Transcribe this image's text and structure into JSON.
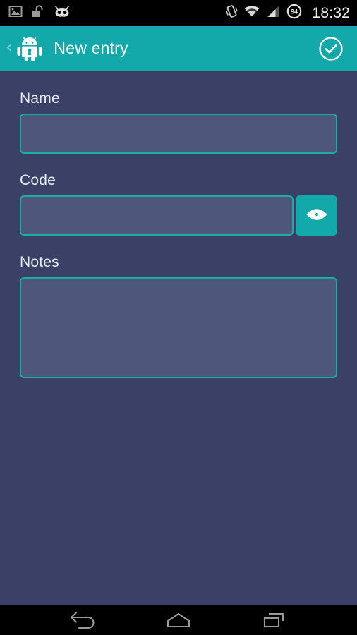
{
  "status_bar": {
    "icons_left": [
      "gallery-image-icon",
      "unlocked-padlock-icon",
      "cyanogenmod-cid-icon"
    ],
    "icons_right": [
      "vibrate-icon",
      "wifi-icon",
      "cellular-signal-icon",
      "battery-icon"
    ],
    "battery_level": "94",
    "clock": "18:32"
  },
  "action_bar": {
    "back_chevron": "‹",
    "app_icon": "android-lock-robot-icon",
    "title": "New entry",
    "done_icon": "circled-checkmark-icon"
  },
  "form": {
    "fields": [
      {
        "label": "Name",
        "value": "",
        "placeholder": ""
      },
      {
        "label": "Code",
        "value": "",
        "placeholder": ""
      },
      {
        "label": "Notes",
        "value": "",
        "placeholder": ""
      }
    ],
    "reveal_code_icon": "eye-icon"
  },
  "nav_bar": {
    "back": "back-arrow-icon",
    "home": "home-icon",
    "recents": "recent-apps-icon"
  },
  "colors": {
    "accent_teal": "#13a8aa",
    "border_teal": "#18b0a6",
    "page_background": "#3b4166",
    "input_fill": "#4f567c",
    "status_bar": "#000000",
    "text_primary": "#ffffff"
  }
}
